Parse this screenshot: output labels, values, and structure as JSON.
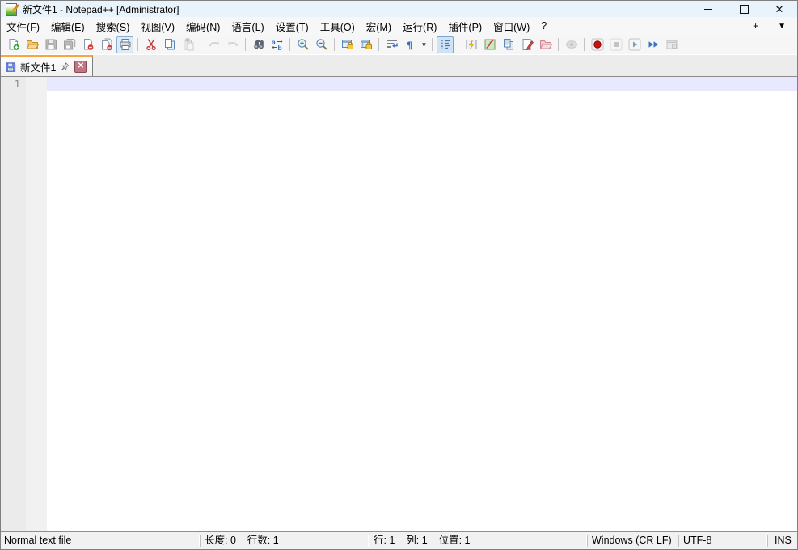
{
  "window": {
    "title": "新文件1 - Notepad++ [Administrator]"
  },
  "menubar": {
    "items": [
      {
        "id": "file",
        "text": "文件",
        "key": "F"
      },
      {
        "id": "edit",
        "text": "编辑",
        "key": "E"
      },
      {
        "id": "search",
        "text": "搜索",
        "key": "S"
      },
      {
        "id": "view",
        "text": "视图",
        "key": "V"
      },
      {
        "id": "encoding",
        "text": "编码",
        "key": "N"
      },
      {
        "id": "language",
        "text": "语言",
        "key": "L"
      },
      {
        "id": "settings",
        "text": "设置",
        "key": "T"
      },
      {
        "id": "tools",
        "text": "工具",
        "key": "O"
      },
      {
        "id": "macro",
        "text": "宏",
        "key": "M"
      },
      {
        "id": "run",
        "text": "运行",
        "key": "R"
      },
      {
        "id": "plugins",
        "text": "插件",
        "key": "P"
      },
      {
        "id": "window",
        "text": "窗口",
        "key": "W"
      },
      {
        "id": "help",
        "text": "?",
        "key": ""
      }
    ],
    "new_tab_label": "+",
    "tab_list_label": "▼"
  },
  "toolbar": {
    "items": [
      {
        "icon": "new-file",
        "state": "normal"
      },
      {
        "icon": "open-folder",
        "state": "normal"
      },
      {
        "icon": "save",
        "state": "disabled"
      },
      {
        "icon": "save-all",
        "state": "disabled"
      },
      {
        "icon": "close-file",
        "state": "normal"
      },
      {
        "icon": "close-all-files",
        "state": "normal"
      },
      {
        "icon": "print",
        "state": "hover"
      },
      {
        "divider": true
      },
      {
        "icon": "cut",
        "state": "normal"
      },
      {
        "icon": "copy",
        "state": "normal"
      },
      {
        "icon": "paste",
        "state": "disabled"
      },
      {
        "divider": true
      },
      {
        "icon": "undo",
        "state": "disabled"
      },
      {
        "icon": "redo",
        "state": "disabled"
      },
      {
        "divider": true
      },
      {
        "icon": "find",
        "state": "normal"
      },
      {
        "icon": "replace",
        "state": "normal"
      },
      {
        "divider": true
      },
      {
        "icon": "zoom-in",
        "state": "normal"
      },
      {
        "icon": "zoom-out",
        "state": "normal"
      },
      {
        "divider": true
      },
      {
        "icon": "sync-vertical-scroll",
        "state": "normal"
      },
      {
        "icon": "sync-horizontal-scroll",
        "state": "normal"
      },
      {
        "divider": true
      },
      {
        "icon": "word-wrap",
        "state": "normal"
      },
      {
        "icon": "show-all-characters",
        "state": "normal"
      },
      {
        "icon": "show-symbols-dropdown",
        "state": "caret"
      },
      {
        "divider": true
      },
      {
        "icon": "indent-guide",
        "state": "active"
      },
      {
        "divider": true
      },
      {
        "icon": "function-list",
        "state": "normal"
      },
      {
        "icon": "document-map",
        "state": "normal"
      },
      {
        "icon": "document-list",
        "state": "normal"
      },
      {
        "icon": "file-pen",
        "state": "normal"
      },
      {
        "icon": "folder-workspace",
        "state": "normal"
      },
      {
        "divider": true
      },
      {
        "icon": "monitoring-eye",
        "state": "disabled"
      },
      {
        "divider": true
      },
      {
        "icon": "record-macro",
        "state": "normal"
      },
      {
        "icon": "stop-macro",
        "state": "disabled"
      },
      {
        "icon": "play-macro",
        "state": "normal"
      },
      {
        "icon": "run-macro-multiple",
        "state": "normal"
      },
      {
        "icon": "save-macro",
        "state": "disabled"
      }
    ]
  },
  "tabbar": {
    "tabs": [
      {
        "label": "新文件1",
        "active": true,
        "saved": true,
        "pinned": false
      }
    ]
  },
  "editor": {
    "line_number": "1",
    "content": "",
    "current_line_color": "#e8e8ff"
  },
  "statusbar": {
    "segments": [
      {
        "id": "doc-type",
        "text": "Normal text file"
      },
      {
        "id": "size",
        "text": "长度: 0    行数: 1"
      },
      {
        "id": "position",
        "text": "行: 1    列: 1    位置: 1"
      },
      {
        "id": "eol",
        "text": "Windows (CR LF)"
      },
      {
        "id": "encoding",
        "text": "UTF-8"
      },
      {
        "id": "insert-mode",
        "text": "INS"
      }
    ]
  }
}
